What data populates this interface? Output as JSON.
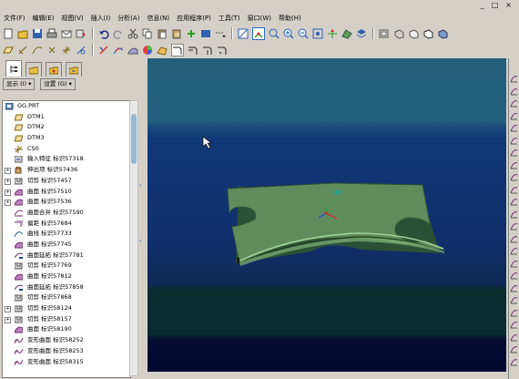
{
  "window": {
    "title": "",
    "controls": [
      "_",
      "□",
      "×"
    ]
  },
  "menu": [
    "文件(F)",
    "编辑(E)",
    "视图(V)",
    "插入(I)",
    "分析(A)",
    "信息(N)",
    "应用程序(P)",
    "工具(T)",
    "窗口(W)",
    "帮助(H)"
  ],
  "panel": {
    "show_dropdown": "显示 (I) ▾",
    "settings_dropdown": "设置 (G) ▾"
  },
  "tree": [
    {
      "label": "GG.PRT",
      "icon": "part-icon",
      "expander": "",
      "level": 0
    },
    {
      "label": "DTM1",
      "icon": "datum-plane-icon",
      "expander": "",
      "level": 1
    },
    {
      "label": "DTM2",
      "icon": "datum-plane-icon",
      "expander": "",
      "level": 1
    },
    {
      "label": "DTM3",
      "icon": "datum-plane-icon",
      "expander": "",
      "level": 1
    },
    {
      "label": "CS0",
      "icon": "coordinate-system-icon",
      "expander": "",
      "level": 1
    },
    {
      "label": "输入特征 标识57318",
      "icon": "import-feature-icon",
      "expander": "",
      "level": 1
    },
    {
      "label": "伸出项 标识57436",
      "icon": "protrusion-icon",
      "expander": "+",
      "level": 1
    },
    {
      "label": "切剪 标识57457",
      "icon": "cut-icon",
      "expander": "+",
      "level": 1
    },
    {
      "label": "曲面 标识57510",
      "icon": "surface-icon",
      "expander": "+",
      "level": 1
    },
    {
      "label": "曲面 标识57536",
      "icon": "surface-icon",
      "expander": "+",
      "level": 1
    },
    {
      "label": "曲面合并 标识57590",
      "icon": "merge-icon",
      "expander": "",
      "level": 1
    },
    {
      "label": "偏距 标识57684",
      "icon": "offset-icon",
      "expander": "",
      "level": 1
    },
    {
      "label": "曲线 标识57733",
      "icon": "curve-icon",
      "expander": "",
      "level": 1
    },
    {
      "label": "曲面 标识57745",
      "icon": "surface-icon",
      "expander": "",
      "level": 1
    },
    {
      "label": "曲面延拓 标识57781",
      "icon": "extend-icon",
      "expander": "",
      "level": 1
    },
    {
      "label": "切剪 标识57769",
      "icon": "cut-icon",
      "expander": "",
      "level": 1
    },
    {
      "label": "曲面 标识57812",
      "icon": "surface-icon",
      "expander": "",
      "level": 1
    },
    {
      "label": "曲面延拓 标识57858",
      "icon": "extend-icon",
      "expander": "",
      "level": 1
    },
    {
      "label": "切剪 标识57868",
      "icon": "cut-icon",
      "expander": "",
      "level": 1
    },
    {
      "label": "切剪 标识58124",
      "icon": "cut-icon",
      "expander": "+",
      "level": 1
    },
    {
      "label": "切剪 标识58157",
      "icon": "cut-icon",
      "expander": "+",
      "level": 1
    },
    {
      "label": "曲面 标识58190",
      "icon": "surface-icon",
      "expander": "",
      "level": 1
    },
    {
      "label": "变形曲面 标识58252",
      "icon": "warp-surface-icon",
      "expander": "",
      "level": 1
    },
    {
      "label": "变形曲面 标识58253",
      "icon": "warp-surface-icon",
      "expander": "",
      "level": 1
    },
    {
      "label": "变形曲面 标识58315",
      "icon": "warp-surface-icon",
      "expander": "",
      "level": 1
    }
  ],
  "colors": {
    "viewport_top": "#24607a",
    "viewport_mid": "#0f2f6a",
    "viewport_bottom": "#040830",
    "model_face": "#5f8c5c",
    "model_edge": "#2f4f2a",
    "selection_blue": "#316ac5"
  }
}
